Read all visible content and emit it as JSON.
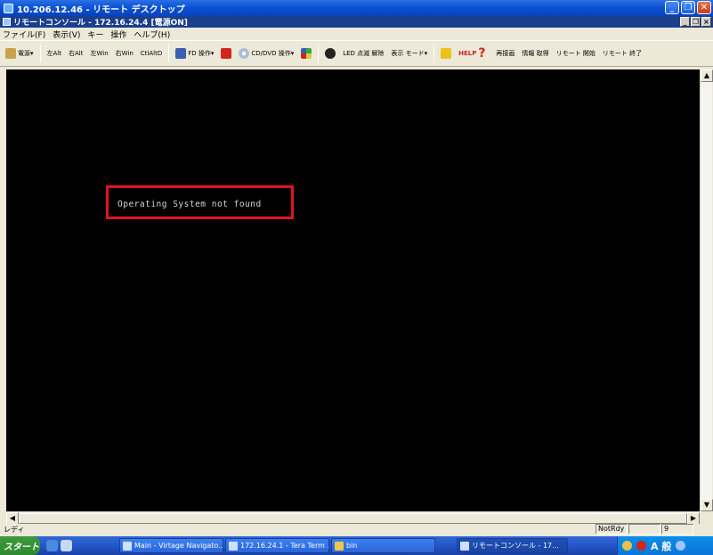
{
  "rdp_window": {
    "title": "10.206.12.46 - リモート デスクトップ",
    "buttons": [
      "minimize",
      "restore",
      "close"
    ]
  },
  "console_window": {
    "title": "リモートコンソール - 172.16.24.4  [電源ON]",
    "buttons": [
      "minimize",
      "maximize",
      "close"
    ]
  },
  "menu": {
    "items": [
      "ファイル(F)",
      "表示(V)",
      "キー",
      "操作",
      "ヘルプ(H)"
    ]
  },
  "toolbar": {
    "items": [
      {
        "label": "電源▾",
        "icon": "power-icon"
      },
      {
        "label": "左Alt",
        "icon": ""
      },
      {
        "label": "右Alt",
        "icon": ""
      },
      {
        "label": "左Win",
        "icon": ""
      },
      {
        "label": "右Win",
        "icon": ""
      },
      {
        "label": "CtlAltD",
        "icon": ""
      },
      {
        "label": "FD 操作▾",
        "icon": "floppy-icon"
      },
      {
        "label": "",
        "icon": "red-square-icon"
      },
      {
        "label": "CD/DVD 操作▾",
        "icon": "cd-icon"
      },
      {
        "label": "",
        "icon": "grid-icon"
      },
      {
        "label": "",
        "icon": "sun-icon"
      },
      {
        "label": "LED 点滅 解除",
        "icon": "led-icon"
      },
      {
        "label": "表示 モード▾",
        "icon": "display-icon"
      },
      {
        "label": "",
        "icon": "info-icon"
      },
      {
        "label": "HELP",
        "icon": "help-icon"
      },
      {
        "label": "再接画",
        "icon": "refresh-icon"
      },
      {
        "label": "情報 取得",
        "icon": "info-get-icon"
      },
      {
        "label": "リモート 開始",
        "icon": "remote-start-icon"
      },
      {
        "label": "リモート 終了",
        "icon": "remote-end-icon"
      }
    ]
  },
  "console": {
    "message": "Operating System not found"
  },
  "statusbar": {
    "left_text": "レディ",
    "panel1": "NotRdy",
    "panel2": "",
    "panel3": "9"
  },
  "taskbar": {
    "start_label": "スタート",
    "tasks": [
      {
        "label": "Main - Virtage Navigato..."
      },
      {
        "label": "172.16.24.1 - Tera Term ..."
      },
      {
        "label": "bin"
      },
      {
        "label": "リモートコンソール - 17..."
      }
    ],
    "tray_text": "A 般"
  },
  "colors": {
    "highlight": "#e0141e",
    "console_bg": "#000000",
    "console_text": "#d8d8d8"
  }
}
